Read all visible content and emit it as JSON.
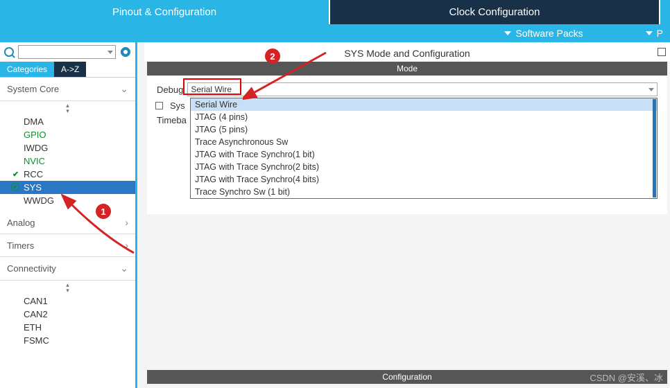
{
  "top_tabs": {
    "pinout": "Pinout & Configuration",
    "clock": "Clock Configuration"
  },
  "sub_bar": {
    "software_packs": "Software Packs",
    "partial": "P"
  },
  "left": {
    "tabs": {
      "categories": "Categories",
      "az": "A->Z"
    },
    "system_core": {
      "label": "System Core",
      "items": [
        "DMA",
        "GPIO",
        "IWDG",
        "NVIC",
        "RCC",
        "SYS",
        "WWDG"
      ]
    },
    "analog": "Analog",
    "timers": "Timers",
    "connectivity": {
      "label": "Connectivity",
      "items": [
        "CAN1",
        "CAN2",
        "ETH",
        "FSMC"
      ]
    }
  },
  "right": {
    "title": "SYS Mode and Configuration",
    "mode_label": "Mode",
    "config_label": "Configuration",
    "debug_label": "Debug",
    "debug_value": "Serial Wire",
    "sys_checkbox_label": "Sys",
    "timebase_label": "Timeba",
    "dropdown": [
      "Serial Wire",
      "JTAG (4 pins)",
      "JTAG (5 pins)",
      "Trace Asynchronous Sw",
      "JTAG with Trace Synchro(1 bit)",
      "JTAG with Trace Synchro(2 bits)",
      "JTAG with Trace Synchro(4 bits)",
      "Trace Synchro Sw (1 bit)"
    ]
  },
  "markers": {
    "one": "1",
    "two": "2"
  },
  "watermark": "CSDN @安溪、冰"
}
